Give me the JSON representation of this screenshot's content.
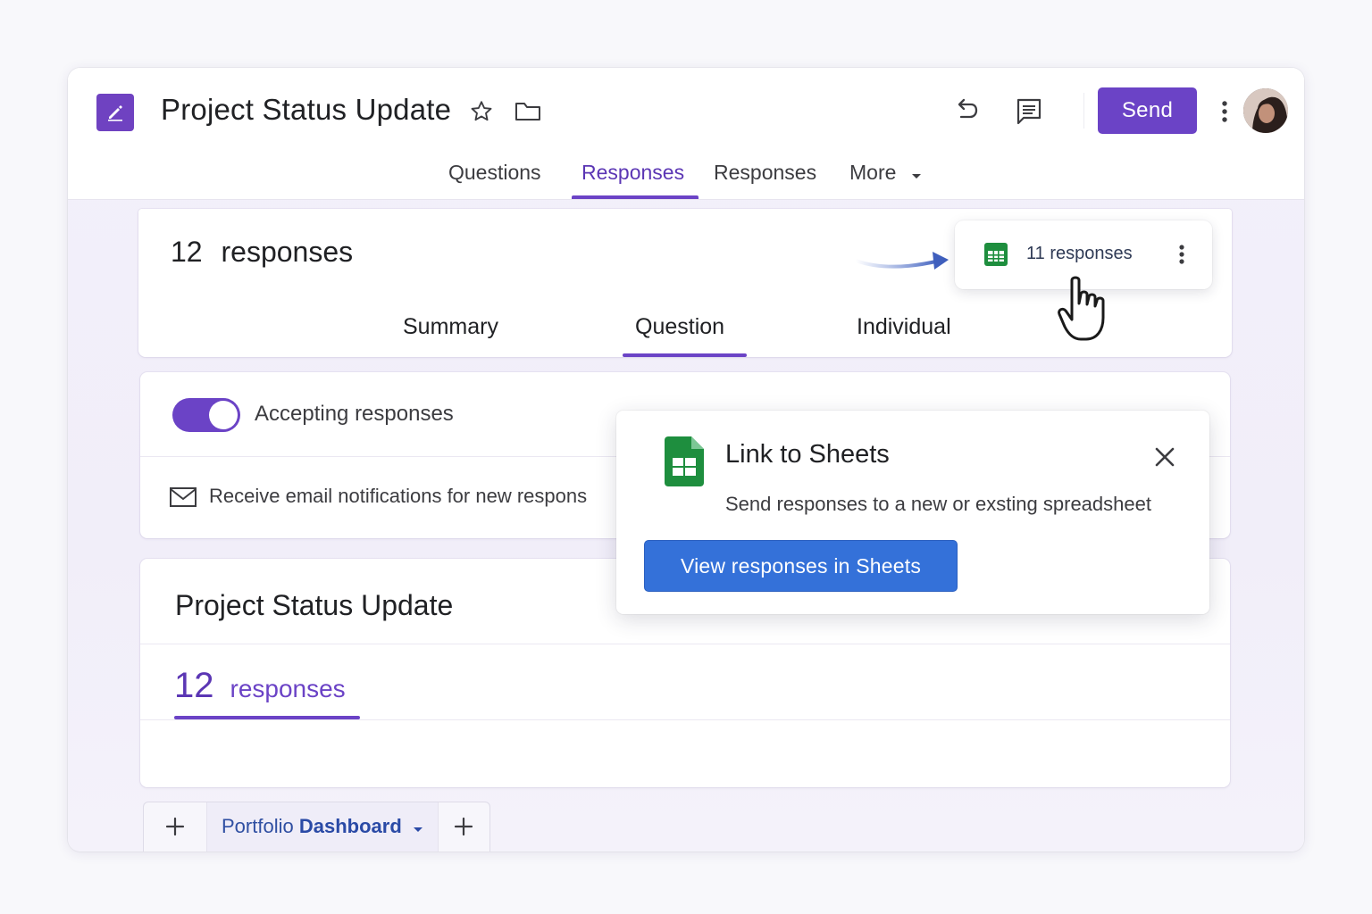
{
  "header": {
    "title": "Project Status Update",
    "send_label": "Send"
  },
  "tabs": [
    {
      "label": "Questions"
    },
    {
      "label": "Responses"
    },
    {
      "label": "Responses"
    },
    {
      "label": "More"
    }
  ],
  "responses_card": {
    "count": "12",
    "count_word": "responses",
    "subtabs": [
      {
        "label": "Summary"
      },
      {
        "label": "Question"
      },
      {
        "label": "Individual"
      }
    ],
    "sheets_chip_label": "11 responses"
  },
  "settings_card": {
    "accepting_label": "Accepting responses",
    "email_label": "Receive email notifications for new respons"
  },
  "popup": {
    "title": "Link to Sheets",
    "description": "Send responses to a new or exsting spreadsheet",
    "button_label": "View responses in Sheets"
  },
  "title_card": {
    "title": "Project Status Update",
    "count": "12",
    "count_word": "responses"
  },
  "sheet_tabs": {
    "prefix": "Portfolio",
    "name": "Dashboard"
  },
  "colors": {
    "accent": "#6b43c6",
    "sheets_green": "#1e8e3e",
    "button_blue": "#3471d9"
  },
  "icons": {
    "app": "pencil-edit-icon",
    "star": "star-icon",
    "folder": "folder-icon",
    "undo": "undo-icon",
    "comment": "comment-icon",
    "more": "more-vert-icon",
    "sheets": "sheets-icon",
    "close": "close-icon",
    "mail": "mail-icon",
    "cursor": "hand-pointer-icon",
    "arrow": "curved-arrow-icon"
  }
}
